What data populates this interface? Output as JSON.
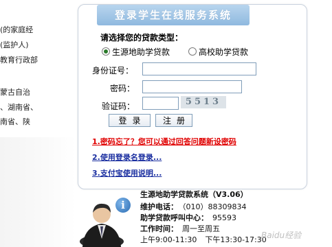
{
  "left_fragments": [
    "(的家庭经",
    "(监护人)",
    "教育行政部",
    "蒙古自治",
    "、湖南省、",
    "南省、陕"
  ],
  "panel": {
    "title": "登录学生在线服务系统",
    "loan_type_label": "请选择您的贷款类型：",
    "radio_options": [
      {
        "label": "生源地助学贷款",
        "selected": true
      },
      {
        "label": "高校助学贷款",
        "selected": false
      }
    ],
    "id_label": "身份证号：",
    "id_value": "",
    "password_label": "密码：",
    "password_value": "",
    "captcha_label": "验证码：",
    "captcha_value": "",
    "captcha_image_text": "5513",
    "login_button": "登录",
    "register_button": "注册",
    "links": [
      "1.密码忘了？您可以通过回答问题新设密码",
      "2.使用登录名登录...",
      "3.支付宝使用说明..."
    ]
  },
  "info": {
    "system_name": "生源地助学贷款系统（V3.06）",
    "phone_label": "维护电话：",
    "phone_value": "（010）88309834",
    "hotline_label": "助学贷款呼叫中心：",
    "hotline_value": "95593",
    "hours_label": "工作时间：",
    "hours_value": "周一至周五",
    "hours_am": "上午9:00-11:30",
    "hours_pm": "下午13:30-17:30"
  },
  "watermark": "Baidu经验",
  "colors": {
    "link_red": "#e00000",
    "link_blue": "#1a2ea0",
    "title_bg": "#8fb9df",
    "radio_dot": "#2a7a2a"
  },
  "icons": {
    "info": "info-icon",
    "person": "person-illustration"
  }
}
